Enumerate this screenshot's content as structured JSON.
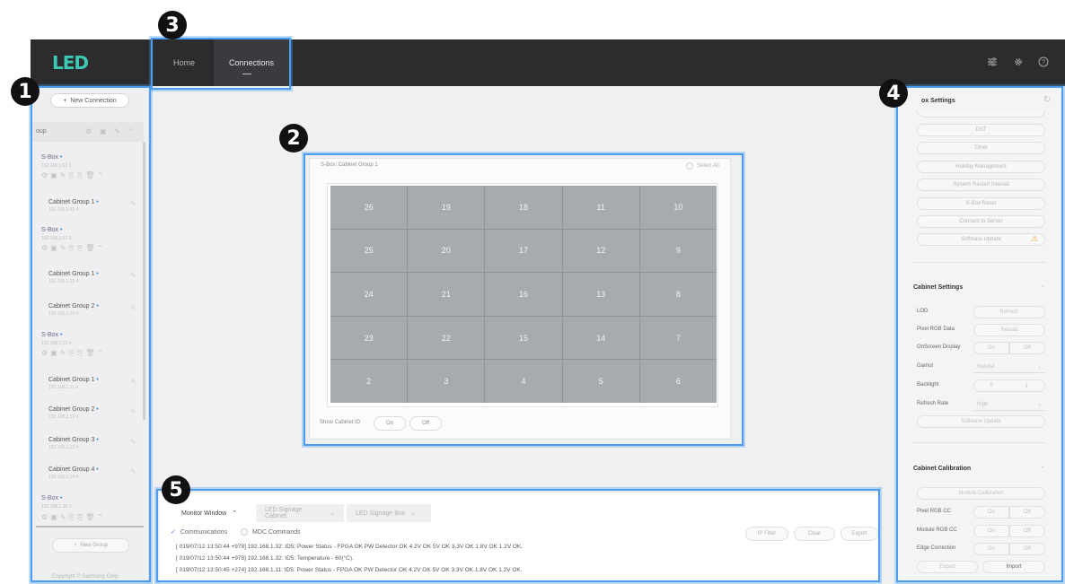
{
  "header": {
    "logo": "LED",
    "tabs": [
      {
        "label": "Home"
      },
      {
        "label": "Connections"
      }
    ],
    "icons": [
      "sliders-icon",
      "gear-icon",
      "help-icon"
    ]
  },
  "sidebar": {
    "new_connection_label": "New Connection",
    "group_label": "oup",
    "sboxes": [
      {
        "title": "S-Box",
        "ip": "192.168.1.61 1",
        "cabinets": [
          {
            "title": "Cabinet Group 1",
            "ip": "192.168.1.41 4"
          }
        ]
      },
      {
        "title": "S-Box",
        "ip": "192.168.1.67 3",
        "cabinets": [
          {
            "title": "Cabinet Group 1",
            "ip": "192.168.1.21 4"
          },
          {
            "title": "Cabinet Group 2",
            "ip": "192.168.1.20 4"
          }
        ]
      },
      {
        "title": "S-Box",
        "ip": "192.168.1.53 4",
        "cabinets": [
          {
            "title": "Cabinet Group 1",
            "ip": "192.168.1.11 4"
          },
          {
            "title": "Cabinet Group 2",
            "ip": "192.168.1.12 4"
          },
          {
            "title": "Cabinet Group 3",
            "ip": "192.168.1.13 4"
          },
          {
            "title": "Cabinet Group 4",
            "ip": "192.168.1.14 4"
          }
        ]
      },
      {
        "title": "S-Box",
        "ip": "192.168.1.30 2"
      }
    ],
    "new_group_label": "New Group",
    "copyright": "Copyright © Samsung Corp."
  },
  "badges": [
    "1",
    "2",
    "3",
    "4",
    "5"
  ],
  "cabinet_panel": {
    "title": "S-Box: Cabinet Group 1",
    "select_all": "Select All",
    "cells": [
      "26",
      "19",
      "18",
      "11",
      "10",
      "25",
      "20",
      "17",
      "12",
      "9",
      "24",
      "21",
      "16",
      "13",
      "8",
      "23",
      "22",
      "15",
      "14",
      "7",
      "2",
      "3",
      "4",
      "5",
      "6"
    ],
    "show_cabinet_id_label": "Show Cabinet ID",
    "on_label": "On",
    "off_label": "Off"
  },
  "right_panel": {
    "sbox_settings_title": "ox Settings",
    "sbox_buttons": [
      "DST",
      "Timer",
      "Holiday Management",
      "System Restart Interval",
      "S-Box Reset",
      "Connect to Server",
      "Software Update"
    ],
    "cabinet_settings_title": "Cabinet Settings",
    "lod_label": "LOD",
    "lod_btn": "Refresh",
    "pixel_rgb_label": "Pixel RGB Data",
    "pixel_rgb_btn": "Reload",
    "osd_label": "OnScreen Display",
    "on": "On",
    "off": "Off",
    "gamut_label": "Gamut",
    "gamut_value": "Natural",
    "backlight_label": "Backlight",
    "backlight_value": "0",
    "refresh_label": "Refresh Rate",
    "refresh_value": "High",
    "cab_software_update": "Software Update",
    "calibration_title": "Cabinet Calibration",
    "module_calibration": "Module Calibration",
    "pixel_rgb_cc": "Pixel RGB CC",
    "module_rgb_cc": "Module RGB CC",
    "edge_correction": "Edge Correction",
    "export": "Export",
    "import": "Import"
  },
  "monitor": {
    "tabs": [
      "Monitor Window",
      "LED Signage Cabinet",
      "LED Signage Box"
    ],
    "communications": "Communications",
    "mdc_commands": "MDC Commands",
    "ip_filter": "IP Filter",
    "clear": "Clear",
    "export": "Export",
    "logs": [
      "[ 019/07/12 13:50:44 +978] 192.168.1.32: ID5: Power Status - FPGA OK PW Detector OK 4.2V OK 5V OK 3.3V OK 1.8V OK 1.2V OK.",
      "[ 019/07/12 13:50:44 +978] 192.168.1.32: ID5: Temperature - 60(°C).",
      "[ 019/07/12 13:50:45 +274] 192.168.1.11: ID5: Power Status - FPGA OK PW Detector OK 4.2V OK 5V OK 3.3V OK 1.8V OK 1.2V OK."
    ]
  }
}
